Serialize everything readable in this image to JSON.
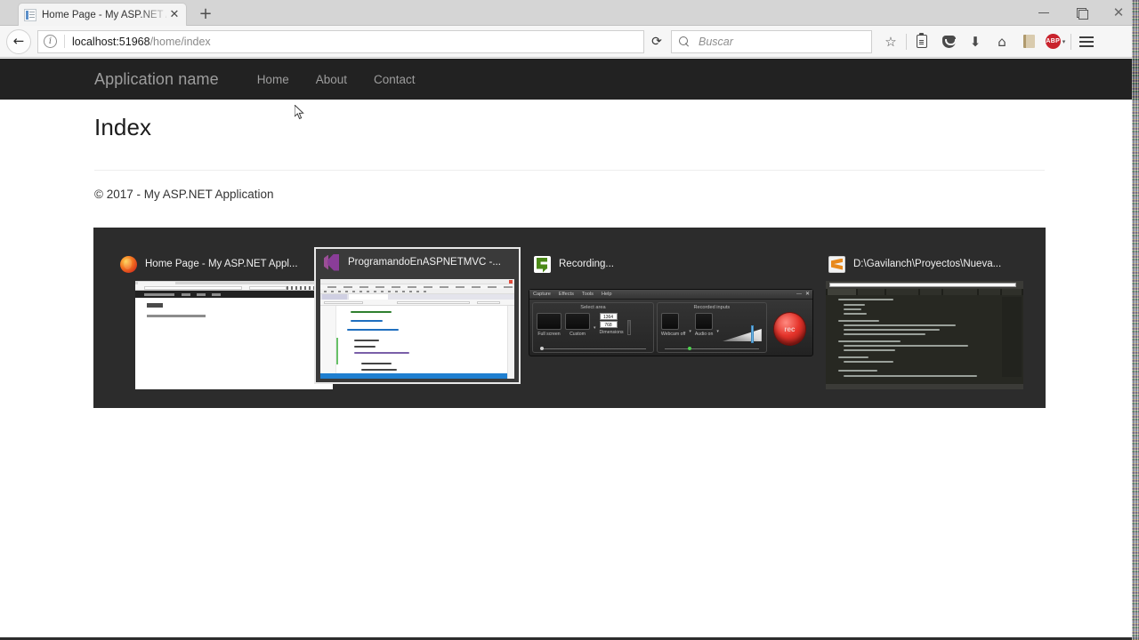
{
  "browser": {
    "tab": {
      "title": "Home Page - My ASP.NET A",
      "favicon_name": "page-favicon",
      "close_label": "✕"
    },
    "new_tab_label": "+",
    "window_controls": {
      "minimize": "—",
      "restore": "❐",
      "close": "✕"
    },
    "back_label": "←",
    "identity_icon": "i",
    "url": {
      "host": "localhost:51968",
      "path": "/home/index",
      "full": "localhost:51968/home/index"
    },
    "reload_label": "⟳",
    "search": {
      "placeholder": "Buscar",
      "icon_name": "search-icon"
    },
    "toolbar_icons": [
      {
        "name": "bookmark-star-icon",
        "glyph": "☆"
      },
      {
        "name": "reader-clipboard-icon",
        "glyph": ""
      },
      {
        "name": "pocket-icon",
        "glyph": ""
      },
      {
        "name": "downloads-icon",
        "glyph": "⬇"
      },
      {
        "name": "home-icon",
        "glyph": "⌂"
      },
      {
        "name": "library-icon",
        "glyph": ""
      },
      {
        "name": "adblock-plus-icon",
        "glyph": "ABP"
      },
      {
        "name": "menu-hamburger-icon",
        "glyph": ""
      }
    ],
    "adblock_label": "ABP",
    "adblock_caret": "▾"
  },
  "site": {
    "brand": "Application name",
    "nav": [
      {
        "label": "Home"
      },
      {
        "label": "About"
      },
      {
        "label": "Contact"
      }
    ],
    "heading": "Index",
    "footer": "© 2017 - My ASP.NET Application"
  },
  "taskbar_peek": {
    "background": "#2c2c2c",
    "thumbnails": [
      {
        "name": "firefox",
        "icon_name": "firefox-icon",
        "label": "Home Page - My ASP.NET Appl...",
        "selected": false
      },
      {
        "name": "visual-studio",
        "icon_name": "visual-studio-icon",
        "label": "ProgramandoEnASPNETMVC -...",
        "selected": true
      },
      {
        "name": "camtasia-recorder",
        "icon_name": "camtasia-icon",
        "label": "Recording...",
        "selected": false
      },
      {
        "name": "sublime-text",
        "icon_name": "sublime-text-icon",
        "label": "D:\\Gavilanch\\Proyectos\\Nueva...",
        "selected": false
      }
    ]
  },
  "camtasia": {
    "menus": [
      "Capture",
      "Effects",
      "Tools",
      "Help"
    ],
    "minimize": "—",
    "close": "✕",
    "groups": [
      {
        "title": "Select area",
        "buttons": [
          {
            "label": "Full screen"
          },
          {
            "label": "Custom"
          },
          {
            "label": "Dimensions"
          }
        ],
        "dimensions": {
          "width": "1364",
          "height": "768"
        }
      },
      {
        "title": "Recorded inputs",
        "buttons": [
          {
            "label": "Webcam off"
          },
          {
            "label": "Audio on"
          }
        ]
      }
    ],
    "rec_label": "rec",
    "accent_red": "#e5342b",
    "accent_green": "#3fae3f"
  }
}
